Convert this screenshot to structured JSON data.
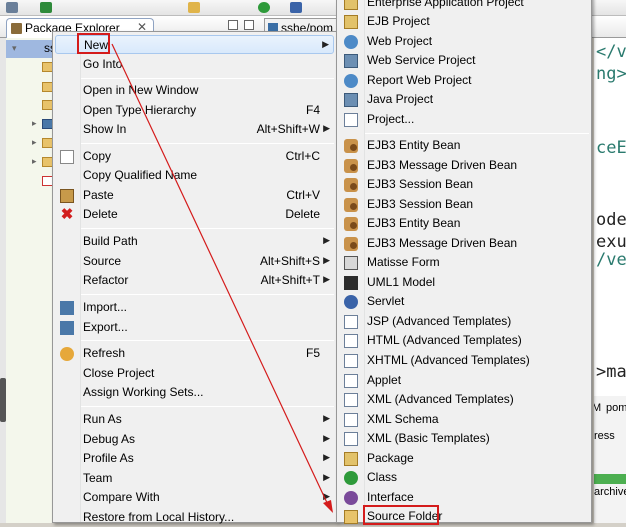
{
  "ide": {
    "package_explorer_tab": "Package Explorer",
    "tab_close": "✕",
    "editor_tab_label": "sshe/pom",
    "tree_items": [
      "ss"
    ],
    "editor_lines": [
      "</v",
      "ng>",
      "ceE",
      "odeh",
      "exus",
      "/ve",
      ">ma"
    ],
    "bottom_tab_pom_1": "M",
    "bottom_tab_pom_2": "pom",
    "bottom_progress": "ress",
    "bottom_archive": "archive"
  },
  "context_menu": {
    "items": [
      {
        "label": "New",
        "shortcut": "",
        "submenu": true,
        "icon": "",
        "highlighted": true
      },
      {
        "label": "Go Into",
        "shortcut": "",
        "submenu": false,
        "icon": ""
      },
      {
        "label": "Open in New Window",
        "shortcut": "",
        "submenu": false,
        "icon": ""
      },
      {
        "label": "Open Type Hierarchy",
        "shortcut": "F4",
        "submenu": false,
        "icon": ""
      },
      {
        "label": "Show In",
        "shortcut": "Alt+Shift+W",
        "submenu": true,
        "icon": ""
      },
      {
        "label": "Copy",
        "shortcut": "Ctrl+C",
        "submenu": false,
        "icon": "copy-icon"
      },
      {
        "label": "Copy Qualified Name",
        "shortcut": "",
        "submenu": false,
        "icon": ""
      },
      {
        "label": "Paste",
        "shortcut": "Ctrl+V",
        "submenu": false,
        "icon": "paste-icon"
      },
      {
        "label": "Delete",
        "shortcut": "Delete",
        "submenu": false,
        "icon": "delete-icon"
      },
      {
        "label": "Build Path",
        "shortcut": "",
        "submenu": true,
        "icon": ""
      },
      {
        "label": "Source",
        "shortcut": "Alt+Shift+S",
        "submenu": true,
        "icon": ""
      },
      {
        "label": "Refactor",
        "shortcut": "Alt+Shift+T",
        "submenu": true,
        "icon": ""
      },
      {
        "label": "Import...",
        "shortcut": "",
        "submenu": false,
        "icon": "import-icon"
      },
      {
        "label": "Export...",
        "shortcut": "",
        "submenu": false,
        "icon": "export-icon"
      },
      {
        "label": "Refresh",
        "shortcut": "F5",
        "submenu": false,
        "icon": "refresh-icon"
      },
      {
        "label": "Close Project",
        "shortcut": "",
        "submenu": false,
        "icon": ""
      },
      {
        "label": "Assign Working Sets...",
        "shortcut": "",
        "submenu": false,
        "icon": ""
      },
      {
        "label": "Run As",
        "shortcut": "",
        "submenu": true,
        "icon": ""
      },
      {
        "label": "Debug As",
        "shortcut": "",
        "submenu": true,
        "icon": ""
      },
      {
        "label": "Profile As",
        "shortcut": "",
        "submenu": true,
        "icon": ""
      },
      {
        "label": "Team",
        "shortcut": "",
        "submenu": true,
        "icon": ""
      },
      {
        "label": "Compare With",
        "shortcut": "",
        "submenu": true,
        "icon": ""
      },
      {
        "label": "Restore from Local History...",
        "shortcut": "",
        "submenu": false,
        "icon": ""
      }
    ]
  },
  "new_submenu": {
    "items": [
      {
        "label": "Enterprise Application Project",
        "icon": "enterprise-project-icon"
      },
      {
        "label": "EJB Project",
        "icon": "ejb-project-icon"
      },
      {
        "label": "Web Project",
        "icon": "web-project-icon"
      },
      {
        "label": "Web Service Project",
        "icon": "web-service-project-icon"
      },
      {
        "label": "Report Web Project",
        "icon": "report-web-project-icon"
      },
      {
        "label": "Java Project",
        "icon": "java-project-icon"
      },
      {
        "label": "Project...",
        "icon": "project-icon"
      },
      {
        "label": "EJB3 Entity Bean",
        "icon": "bean-icon"
      },
      {
        "label": "EJB3 Message Driven Bean",
        "icon": "bean-icon"
      },
      {
        "label": "EJB3 Session Bean",
        "icon": "bean-icon"
      },
      {
        "label": "EJB3 Session Bean",
        "icon": "bean-icon"
      },
      {
        "label": "EJB3 Entity Bean",
        "icon": "bean-icon"
      },
      {
        "label": "EJB3 Message Driven Bean",
        "icon": "bean-icon"
      },
      {
        "label": "Matisse Form",
        "icon": "matisse-form-icon"
      },
      {
        "label": "UML1 Model",
        "icon": "uml-model-icon"
      },
      {
        "label": "Servlet",
        "icon": "servlet-icon"
      },
      {
        "label": "JSP (Advanced Templates)",
        "icon": "jsp-icon"
      },
      {
        "label": "HTML (Advanced Templates)",
        "icon": "html-icon"
      },
      {
        "label": "XHTML (Advanced Templates)",
        "icon": "xhtml-icon"
      },
      {
        "label": "Applet",
        "icon": "applet-icon"
      },
      {
        "label": "XML (Advanced Templates)",
        "icon": "xml-icon"
      },
      {
        "label": "XML Schema",
        "icon": "xml-schema-icon"
      },
      {
        "label": "XML (Basic Templates)",
        "icon": "xml-icon"
      },
      {
        "label": "Package",
        "icon": "package-icon"
      },
      {
        "label": "Class",
        "icon": "class-icon"
      },
      {
        "label": "Interface",
        "icon": "interface-icon"
      },
      {
        "label": "Source Folder",
        "icon": "source-folder-icon"
      }
    ]
  },
  "annotation_color": "#d41b1b"
}
